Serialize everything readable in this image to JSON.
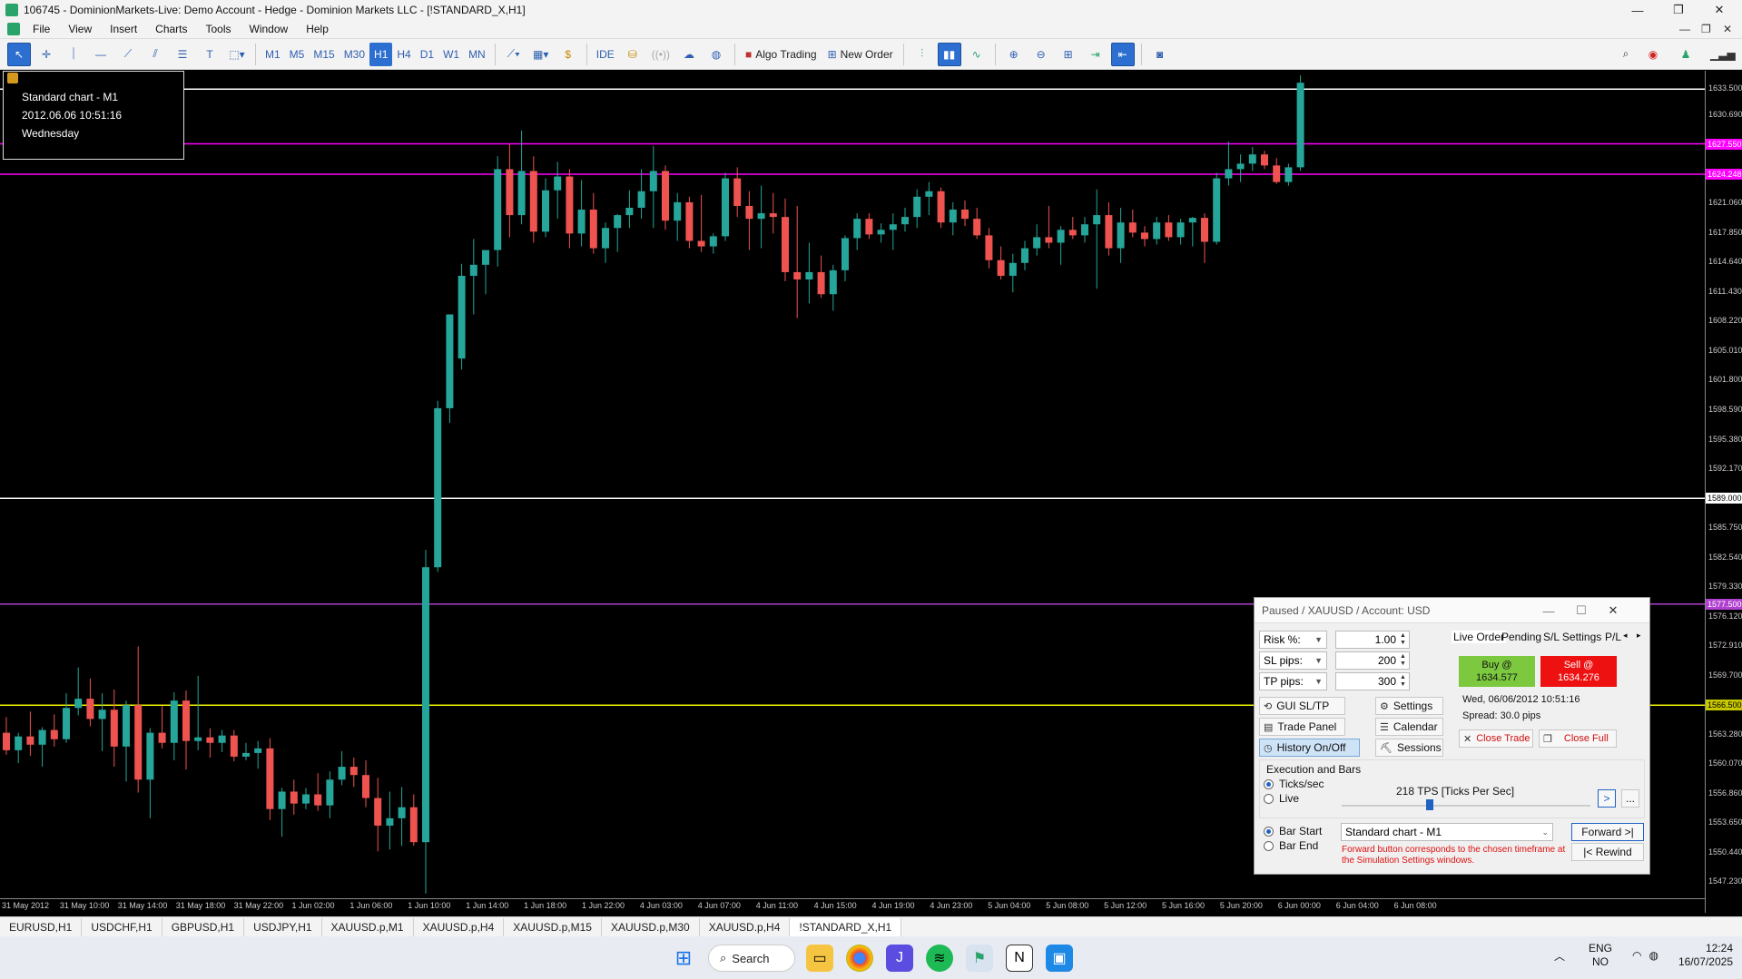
{
  "window": {
    "title": "106745 - DominionMarkets-Live: Demo Account - Hedge - Dominion Markets LLC - [!STANDARD_X,H1]",
    "min": "—",
    "max": "❐",
    "close": "✕"
  },
  "menu": [
    "File",
    "View",
    "Insert",
    "Charts",
    "Tools",
    "Window",
    "Help"
  ],
  "toolbar": {
    "timeframes": [
      "M1",
      "M5",
      "M15",
      "M30",
      "H1",
      "H4",
      "D1",
      "W1",
      "MN"
    ],
    "selected_timeframe": "H1",
    "ide_label": "IDE",
    "algo_trading": "Algo Trading",
    "new_order": "New Order"
  },
  "infobox": {
    "line1": "Standard chart - M1",
    "line2": "2012.06.06 10:51:16",
    "line3": "Wednesday"
  },
  "price_scale": {
    "ticks": [
      "1633.500",
      "1630.690",
      "1621.060",
      "1617.850",
      "1614.640",
      "1611.430",
      "1608.220",
      "1605.010",
      "1601.800",
      "1598.590",
      "1595.380",
      "1592.170",
      "1589.000",
      "1585.750",
      "1582.540",
      "1579.330",
      "1576.120",
      "1572.910",
      "1569.700",
      "1566.500",
      "1563.280",
      "1560.070",
      "1556.860",
      "1553.650",
      "1550.440",
      "1547.230"
    ],
    "tag_magenta_1": "1627.550",
    "tag_magenta_2": "1624.248",
    "tag_purple": "1577.500",
    "tag_yellow": "1566.500",
    "tag_white": "1589.000"
  },
  "time_scale": [
    "31 May 2012",
    "31 May 10:00",
    "31 May 14:00",
    "31 May 18:00",
    "31 May 22:00",
    "1 Jun 02:00",
    "1 Jun 06:00",
    "1 Jun 10:00",
    "1 Jun 14:00",
    "1 Jun 18:00",
    "1 Jun 22:00",
    "4 Jun 03:00",
    "4 Jun 07:00",
    "4 Jun 11:00",
    "4 Jun 15:00",
    "4 Jun 19:00",
    "4 Jun 23:00",
    "5 Jun 04:00",
    "5 Jun 08:00",
    "5 Jun 12:00",
    "5 Jun 16:00",
    "5 Jun 20:00",
    "6 Jun 00:00",
    "6 Jun 04:00",
    "6 Jun 08:00"
  ],
  "chart_data": {
    "type": "candlestick",
    "symbol": "!STANDARD_X,H1",
    "ylim": [
      1545.5,
      1635.5
    ],
    "up_color": "#26a69a",
    "down_color": "#ef5350",
    "hlines": [
      {
        "price": 1633.5,
        "color": "#ffffff"
      },
      {
        "price": 1627.55,
        "color": "#ff00ff"
      },
      {
        "price": 1624.248,
        "color": "#ff00ff"
      },
      {
        "price": 1589.0,
        "color": "#ffffff"
      },
      {
        "price": 1577.5,
        "color": "#b040d0"
      },
      {
        "price": 1566.5,
        "color": "#f0f000"
      }
    ],
    "candles": [
      [
        1563.5,
        1565.2,
        1561.1,
        1561.6
      ],
      [
        1561.6,
        1563.5,
        1560.2,
        1563.1
      ],
      [
        1563.1,
        1565.8,
        1561.0,
        1562.2
      ],
      [
        1562.2,
        1564.1,
        1559.8,
        1563.8
      ],
      [
        1563.8,
        1565.5,
        1562.0,
        1562.8
      ],
      [
        1562.8,
        1567.8,
        1562.4,
        1566.2
      ],
      [
        1566.2,
        1570.6,
        1565.4,
        1567.2
      ],
      [
        1567.2,
        1569.4,
        1564.2,
        1565.0
      ],
      [
        1565.0,
        1567.8,
        1561.5,
        1566.0
      ],
      [
        1566.0,
        1568.2,
        1559.8,
        1562.0
      ],
      [
        1562.0,
        1567.0,
        1558.2,
        1566.5
      ],
      [
        1566.5,
        1572.9,
        1557.0,
        1558.4
      ],
      [
        1558.4,
        1564.0,
        1554.2,
        1563.5
      ],
      [
        1563.5,
        1566.4,
        1561.8,
        1562.4
      ],
      [
        1562.4,
        1567.9,
        1560.5,
        1567.0
      ],
      [
        1567.0,
        1568.1,
        1559.5,
        1562.6
      ],
      [
        1562.6,
        1569.7,
        1561.6,
        1563.0
      ],
      [
        1563.0,
        1564.0,
        1560.8,
        1562.4
      ],
      [
        1562.4,
        1563.8,
        1561.4,
        1563.2
      ],
      [
        1563.2,
        1563.8,
        1560.4,
        1560.9
      ],
      [
        1560.9,
        1562.4,
        1560.5,
        1561.3
      ],
      [
        1561.3,
        1562.6,
        1559.6,
        1561.8
      ],
      [
        1561.8,
        1562.9,
        1554.0,
        1555.2
      ],
      [
        1555.2,
        1557.5,
        1552.2,
        1557.1
      ],
      [
        1557.1,
        1558.4,
        1554.6,
        1555.8
      ],
      [
        1555.8,
        1557.5,
        1555.2,
        1556.8
      ],
      [
        1556.8,
        1559.1,
        1555.0,
        1555.6
      ],
      [
        1555.6,
        1559.3,
        1554.2,
        1558.4
      ],
      [
        1558.4,
        1561.5,
        1557.8,
        1559.8
      ],
      [
        1559.8,
        1560.8,
        1557.6,
        1558.9
      ],
      [
        1558.9,
        1560.5,
        1555.4,
        1556.4
      ],
      [
        1556.4,
        1558.6,
        1550.6,
        1553.4
      ],
      [
        1553.4,
        1557.1,
        1550.8,
        1554.2
      ],
      [
        1554.2,
        1557.6,
        1551.2,
        1555.4
      ],
      [
        1555.4,
        1556.8,
        1551.2,
        1551.6
      ],
      [
        1551.6,
        1583.4,
        1546.0,
        1581.5
      ],
      [
        1581.5,
        1599.6,
        1581.0,
        1598.8
      ],
      [
        1598.8,
        1604.2,
        1597.2,
        1609.0
      ],
      [
        1604.2,
        1614.5,
        1603.0,
        1613.2
      ],
      [
        1613.2,
        1617.2,
        1609.0,
        1614.4
      ],
      [
        1614.4,
        1616.0,
        1611.2,
        1616.0
      ],
      [
        1616.0,
        1626.2,
        1614.2,
        1624.8
      ],
      [
        1624.8,
        1627.5,
        1617.4,
        1619.8
      ],
      [
        1619.8,
        1629.0,
        1618.8,
        1624.6
      ],
      [
        1624.6,
        1626.2,
        1616.8,
        1618.0
      ],
      [
        1618.0,
        1623.8,
        1617.4,
        1622.5
      ],
      [
        1622.5,
        1625.6,
        1619.4,
        1624.0
      ],
      [
        1624.0,
        1624.8,
        1616.2,
        1617.8
      ],
      [
        1617.8,
        1623.6,
        1616.4,
        1620.4
      ],
      [
        1620.4,
        1622.2,
        1615.6,
        1616.2
      ],
      [
        1616.2,
        1619.0,
        1614.6,
        1618.4
      ],
      [
        1618.4,
        1619.9,
        1615.8,
        1619.8
      ],
      [
        1619.8,
        1622.5,
        1618.4,
        1620.6
      ],
      [
        1620.6,
        1624.8,
        1619.4,
        1622.4
      ],
      [
        1622.4,
        1627.3,
        1618.4,
        1624.6
      ],
      [
        1624.6,
        1625.2,
        1618.2,
        1619.2
      ],
      [
        1619.2,
        1622.2,
        1617.0,
        1621.2
      ],
      [
        1621.2,
        1621.8,
        1616.2,
        1617.0
      ],
      [
        1617.0,
        1622.0,
        1615.8,
        1616.4
      ],
      [
        1616.4,
        1617.8,
        1615.6,
        1617.5
      ],
      [
        1617.5,
        1624.4,
        1617.0,
        1623.8
      ],
      [
        1623.8,
        1625.0,
        1619.6,
        1620.8
      ],
      [
        1620.8,
        1622.4,
        1616.0,
        1619.4
      ],
      [
        1619.4,
        1623.0,
        1616.2,
        1620.0
      ],
      [
        1620.0,
        1622.2,
        1617.8,
        1619.6
      ],
      [
        1619.6,
        1621.6,
        1612.6,
        1613.6
      ],
      [
        1613.6,
        1620.8,
        1608.6,
        1612.8
      ],
      [
        1612.8,
        1616.8,
        1610.2,
        1613.6
      ],
      [
        1613.6,
        1615.4,
        1610.8,
        1611.2
      ],
      [
        1611.2,
        1614.4,
        1609.4,
        1613.8
      ],
      [
        1613.8,
        1617.6,
        1612.6,
        1617.3
      ],
      [
        1617.3,
        1620.0,
        1616.0,
        1619.4
      ],
      [
        1619.4,
        1620.0,
        1617.2,
        1617.7
      ],
      [
        1617.7,
        1618.9,
        1616.8,
        1618.2
      ],
      [
        1618.2,
        1620.0,
        1616.0,
        1618.8
      ],
      [
        1618.8,
        1620.6,
        1618.0,
        1619.6
      ],
      [
        1619.6,
        1622.6,
        1618.4,
        1621.8
      ],
      [
        1621.8,
        1623.4,
        1619.8,
        1622.4
      ],
      [
        1622.4,
        1622.8,
        1618.4,
        1619.0
      ],
      [
        1619.0,
        1621.2,
        1617.6,
        1620.4
      ],
      [
        1620.4,
        1621.4,
        1618.6,
        1619.4
      ],
      [
        1619.4,
        1620.6,
        1617.2,
        1617.6
      ],
      [
        1617.6,
        1618.4,
        1614.0,
        1614.9
      ],
      [
        1614.9,
        1616.4,
        1612.8,
        1613.2
      ],
      [
        1613.2,
        1615.6,
        1611.4,
        1614.6
      ],
      [
        1614.6,
        1617.0,
        1613.8,
        1616.2
      ],
      [
        1616.2,
        1618.8,
        1615.4,
        1617.4
      ],
      [
        1617.4,
        1620.8,
        1616.2,
        1616.8
      ],
      [
        1616.8,
        1618.6,
        1614.4,
        1618.2
      ],
      [
        1618.2,
        1619.6,
        1617.2,
        1617.6
      ],
      [
        1617.6,
        1619.6,
        1616.8,
        1618.8
      ],
      [
        1618.8,
        1622.6,
        1611.8,
        1619.8
      ],
      [
        1619.8,
        1621.2,
        1615.4,
        1616.2
      ],
      [
        1616.2,
        1620.6,
        1614.6,
        1619.0
      ],
      [
        1619.0,
        1620.4,
        1617.4,
        1617.9
      ],
      [
        1617.9,
        1618.6,
        1616.4,
        1617.2
      ],
      [
        1617.2,
        1619.6,
        1616.6,
        1619.0
      ],
      [
        1619.0,
        1619.8,
        1617.0,
        1617.4
      ],
      [
        1617.4,
        1619.4,
        1616.6,
        1619.0
      ],
      [
        1619.0,
        1619.6,
        1616.4,
        1619.5
      ],
      [
        1619.5,
        1620.0,
        1614.6,
        1616.9
      ],
      [
        1616.9,
        1624.4,
        1616.6,
        1623.8
      ],
      [
        1623.8,
        1627.8,
        1623.0,
        1624.8
      ],
      [
        1624.8,
        1626.4,
        1623.4,
        1625.4
      ],
      [
        1625.4,
        1627.2,
        1624.6,
        1626.4
      ],
      [
        1626.4,
        1626.8,
        1624.8,
        1625.2
      ],
      [
        1625.2,
        1626.0,
        1623.2,
        1623.4
      ],
      [
        1623.4,
        1625.4,
        1623.0,
        1625.0
      ],
      [
        1625.0,
        1635.0,
        1624.6,
        1634.2
      ]
    ]
  },
  "panel": {
    "title": "Paused / XAUUSD / Account: USD",
    "risk_label": "Risk %:",
    "risk_value": "1.00",
    "sl_label": "SL pips:",
    "sl_value": "200",
    "tp_label": "TP pips:",
    "tp_value": "300",
    "btn_gui": "GUI SL/TP",
    "btn_settings": "Settings",
    "btn_trade_panel": "Trade Panel",
    "btn_calendar": "Calendar",
    "btn_history": "History On/Off",
    "btn_sessions": "Sessions",
    "tabs": [
      "Live Order",
      "Pending",
      "S/L Settings",
      "P/L"
    ],
    "buy_label": "Buy @",
    "buy_price": "1634.577",
    "sell_label": "Sell @",
    "sell_price": "1634.276",
    "datetime": "Wed, 06/06/2012  10:51:16",
    "spread": "Spread: 30.0 pips",
    "close_trade": "Close Trade",
    "close_full": "Close Full",
    "exec_title": "Execution and Bars",
    "ticks_sec": "Ticks/sec",
    "live": "Live",
    "tps": "218 TPS [Ticks Per Sec]",
    "bar_start": "Bar Start",
    "bar_end": "Bar End",
    "chart_select": "Standard chart - M1",
    "forward": "Forward >|",
    "rewind": "|< Rewind",
    "note": "Forward button corresponds to the chosen timeframe at the Simulation Settings windows.",
    "next_btn": ">",
    "more_btn": "..."
  },
  "tabs": [
    "EURUSD,H1",
    "USDCHF,H1",
    "GBPUSD,H1",
    "USDJPY,H1",
    "XAUUSD.p,M1",
    "XAUUSD.p,H4",
    "XAUUSD.p,M15",
    "XAUUSD.p,M30",
    "XAUUSD.p,H4",
    "!STANDARD_X,H1"
  ],
  "active_tab": "!STANDARD_X,H1",
  "taskbar": {
    "search": "Search",
    "lang1": "ENG",
    "lang2": "NO",
    "time": "12:24",
    "date": "16/07/2025"
  }
}
